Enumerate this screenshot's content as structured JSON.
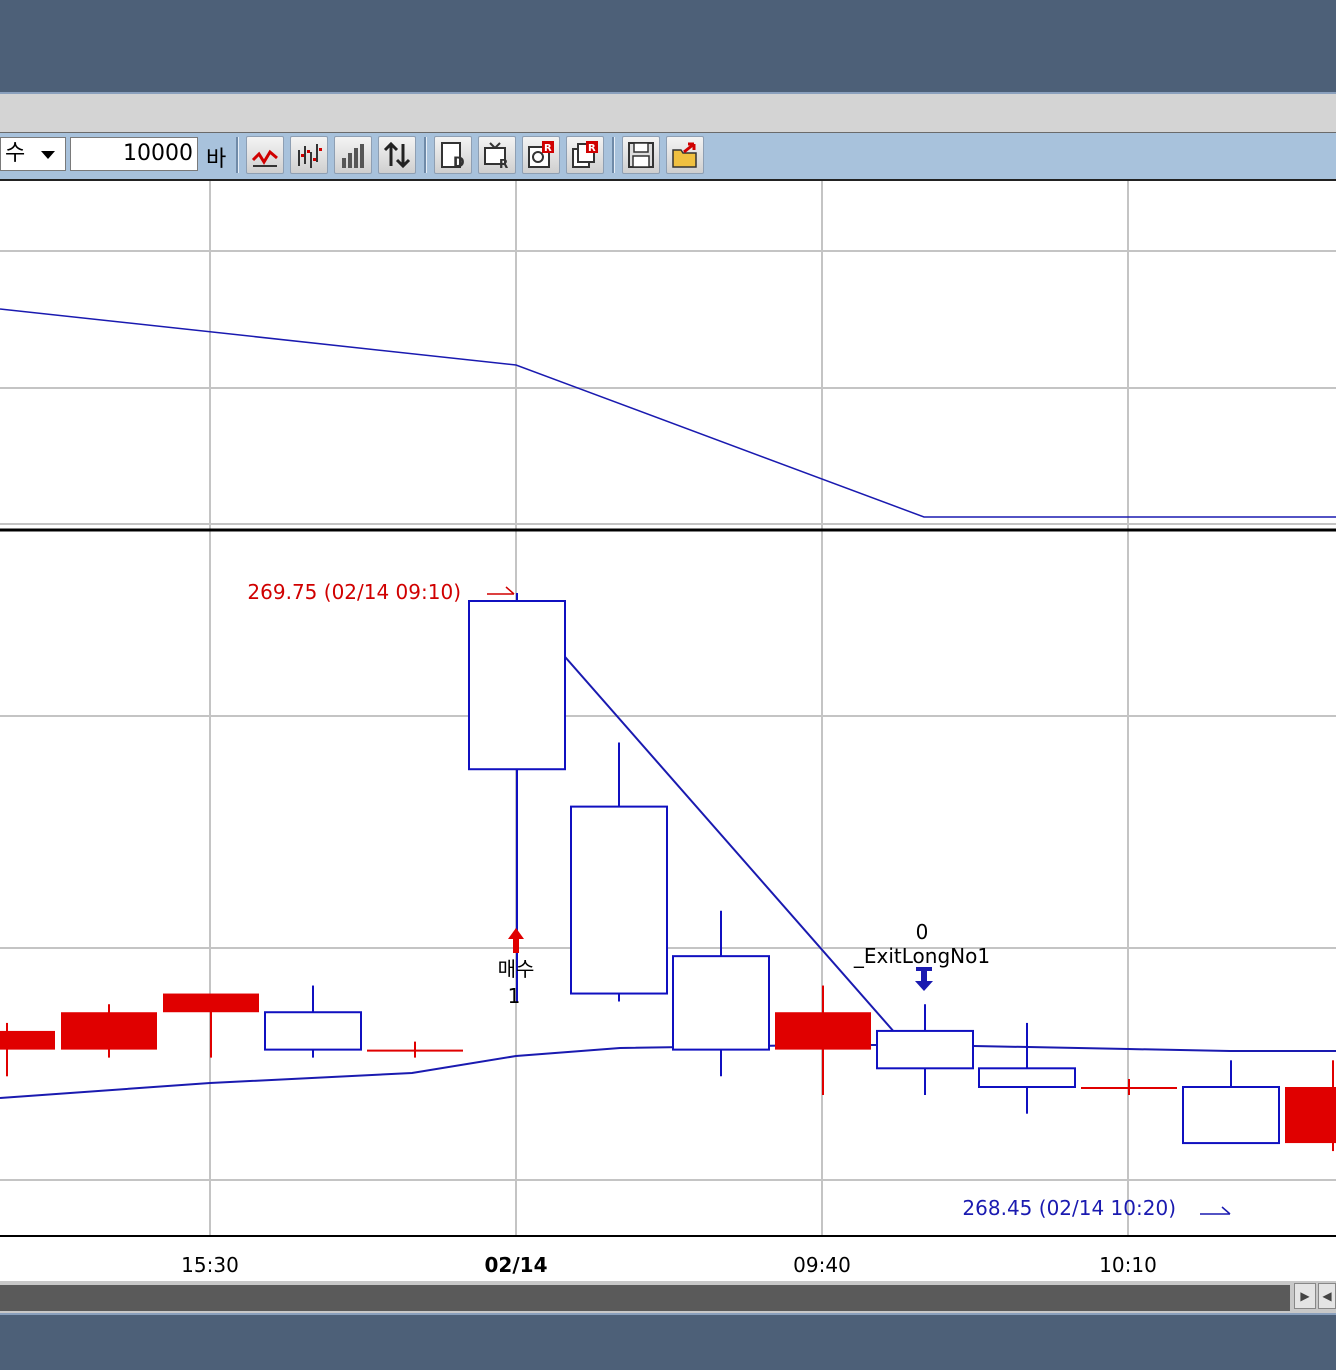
{
  "toolbar": {
    "chart_type_value": "수",
    "bar_count_value": "10000",
    "bar_count_unit": "바",
    "buttons": [
      {
        "name": "indicator-button",
        "icon": "line-chart-icon"
      },
      {
        "name": "bar-chart-button",
        "icon": "ohlc-bars-icon"
      },
      {
        "name": "volume-chart-button",
        "icon": "volume-bars-icon"
      },
      {
        "name": "sort-button",
        "icon": "up-down-arrows-icon"
      },
      {
        "name": "document-d-button",
        "icon": "document-d-icon"
      },
      {
        "name": "tv-r-button",
        "icon": "tv-r-icon"
      },
      {
        "name": "gear-r-button",
        "icon": "gear-r-icon"
      },
      {
        "name": "copy-r-button",
        "icon": "copy-r-icon"
      },
      {
        "name": "save-button",
        "icon": "floppy-disk-icon"
      },
      {
        "name": "open-folder-button",
        "icon": "open-folder-icon"
      }
    ]
  },
  "colors": {
    "up_candle": "#e00000",
    "down_candle": "#1010c0",
    "grid": "#c4c4c4",
    "indicator_line": "#1a1ab0",
    "toolbar_bg": "#a8c2dc"
  },
  "chart_data": {
    "type": "candlestick",
    "x_tick_labels": [
      "15:30",
      "02/14",
      "09:40",
      "10:10"
    ],
    "x_tick_bold": [
      false,
      true,
      false,
      false
    ],
    "price_candles": [
      {
        "open": 268.55,
        "high": 268.6,
        "low": 268.5,
        "close": 268.6,
        "color": "red"
      },
      {
        "open": 268.55,
        "high": 268.65,
        "low": 268.55,
        "close": 268.65,
        "color": "red"
      },
      {
        "open": 268.65,
        "high": 268.65,
        "low": 268.55,
        "close": 268.7,
        "color": "red"
      },
      {
        "open": 268.65,
        "high": 268.7,
        "low": 268.55,
        "close": 268.55,
        "color": "blue"
      },
      {
        "open": 268.55,
        "high": 268.55,
        "low": 268.55,
        "close": 268.55,
        "color": "red"
      },
      {
        "open": 269.75,
        "high": 269.75,
        "low": 268.7,
        "close": 269.3,
        "color": "blue"
      },
      {
        "open": 269.2,
        "high": 269.35,
        "low": 268.7,
        "close": 268.7,
        "color": "blue"
      },
      {
        "open": 268.8,
        "high": 268.9,
        "low": 268.5,
        "close": 268.55,
        "color": "blue"
      },
      {
        "open": 268.55,
        "high": 268.7,
        "low": 268.45,
        "close": 268.65,
        "color": "red"
      },
      {
        "open": 268.6,
        "high": 268.65,
        "low": 268.45,
        "close": 268.5,
        "color": "blue"
      },
      {
        "open": 268.5,
        "high": 268.6,
        "low": 268.4,
        "close": 268.45,
        "color": "blue"
      },
      {
        "open": 268.45,
        "high": 268.45,
        "low": 268.45,
        "close": 268.45,
        "color": "red"
      },
      {
        "open": 268.45,
        "high": 268.5,
        "low": 268.45,
        "close": 268.3,
        "color": "blue"
      },
      {
        "open": 268.3,
        "high": 268.5,
        "low": 268.3,
        "close": 268.45,
        "color": "red"
      }
    ],
    "signals": {
      "buy": {
        "label": "매수",
        "qty": "1"
      },
      "exit": {
        "label": "_ExitLongNo1",
        "qty": "0"
      }
    },
    "annotations": {
      "high": "269.75 (02/14 09:10)",
      "low": "268.45 (02/14 10:20)"
    }
  }
}
